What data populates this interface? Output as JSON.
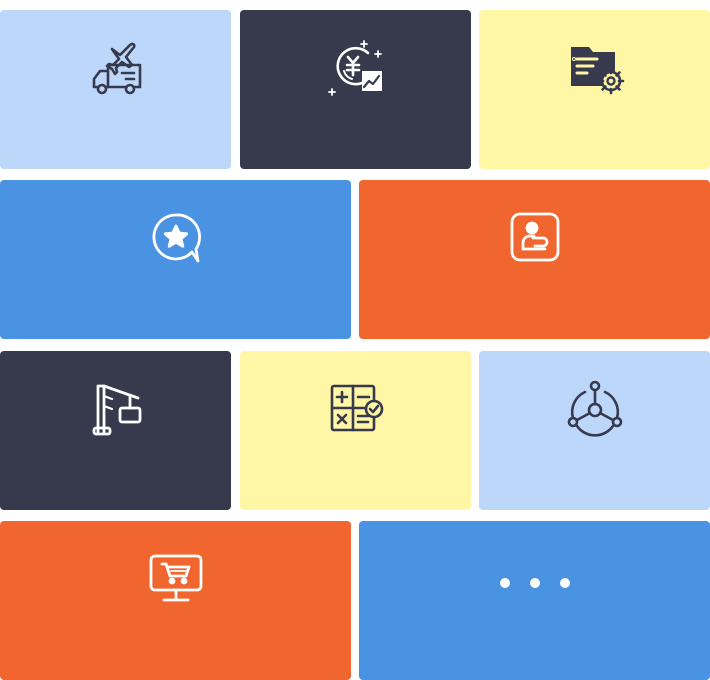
{
  "colors": {
    "light_blue": "#bdd7fb",
    "dark_navy": "#373a4d",
    "light_yellow": "#fff6a6",
    "blue": "#4a93e2",
    "orange": "#f1652e",
    "icon_dark": "#373a4d",
    "icon_light": "#ffffff"
  },
  "tiles": [
    {
      "icon": "delivery-truck-plane-icon",
      "color": "light_blue",
      "label": ""
    },
    {
      "icon": "yuan-coin-growth-icon",
      "color": "dark_navy",
      "label": ""
    },
    {
      "icon": "folder-settings-icon",
      "color": "light_yellow",
      "label": ""
    },
    {
      "icon": "star-chat-bubble-icon",
      "color": "blue",
      "label": ""
    },
    {
      "icon": "user-badge-icon",
      "color": "orange",
      "label": ""
    },
    {
      "icon": "crane-icon",
      "color": "dark_navy",
      "label": ""
    },
    {
      "icon": "calculator-check-icon",
      "color": "light_yellow",
      "label": ""
    },
    {
      "icon": "network-hub-icon",
      "color": "light_blue",
      "label": ""
    },
    {
      "icon": "monitor-cart-icon",
      "color": "orange",
      "label": ""
    },
    {
      "icon": "more-dots-icon",
      "color": "blue",
      "label": ""
    }
  ]
}
